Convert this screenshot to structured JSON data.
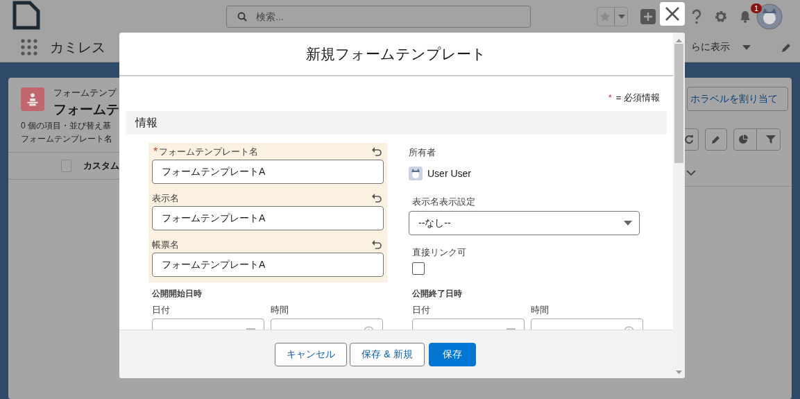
{
  "app_header": {
    "search": {
      "placeholder": "検索..."
    },
    "notification_count": "1"
  },
  "nav": {
    "app_name": "カミレス",
    "more_label": "らに表示"
  },
  "list_view": {
    "object_label": "フォームテンプ",
    "title": "フォームテ",
    "summary": "0 個の項目・並び替え基",
    "filter_text": "フォームテンプレート名",
    "column_1": "カスタム",
    "select_all_checked": false,
    "assign_button": "ホラベルを割り当て"
  },
  "modal": {
    "title": "新規フォームテンプレート",
    "required_mark": "*",
    "required_note": "= 必須情報",
    "section": "情報",
    "fields": [
      {
        "label": "フォームテンプレート名",
        "required": true,
        "edited": true,
        "value": "フォームテンプレートA"
      },
      {
        "label": "表示名",
        "required": false,
        "edited": true,
        "value": "フォームテンプレートA"
      },
      {
        "label": "帳票名",
        "required": false,
        "edited": true,
        "value": "フォームテンプレートA"
      }
    ],
    "owner": {
      "label": "所有者",
      "name": "User User"
    },
    "display_setting": {
      "label": "表示名表示設定",
      "value": "--なし--"
    },
    "direct_link": {
      "label": "直接リンク可",
      "checked": false
    },
    "datetimes": [
      {
        "label": "公開開始日時",
        "date_label": "日付",
        "time_label": "時間"
      },
      {
        "label": "公開終了日時",
        "date_label": "日付",
        "time_label": "時間"
      }
    ],
    "buttons": [
      {
        "label": "キャンセル",
        "kind": "neutral"
      },
      {
        "label": "保存 & 新規",
        "kind": "neutral"
      },
      {
        "label": "保存",
        "kind": "brand"
      }
    ]
  }
}
